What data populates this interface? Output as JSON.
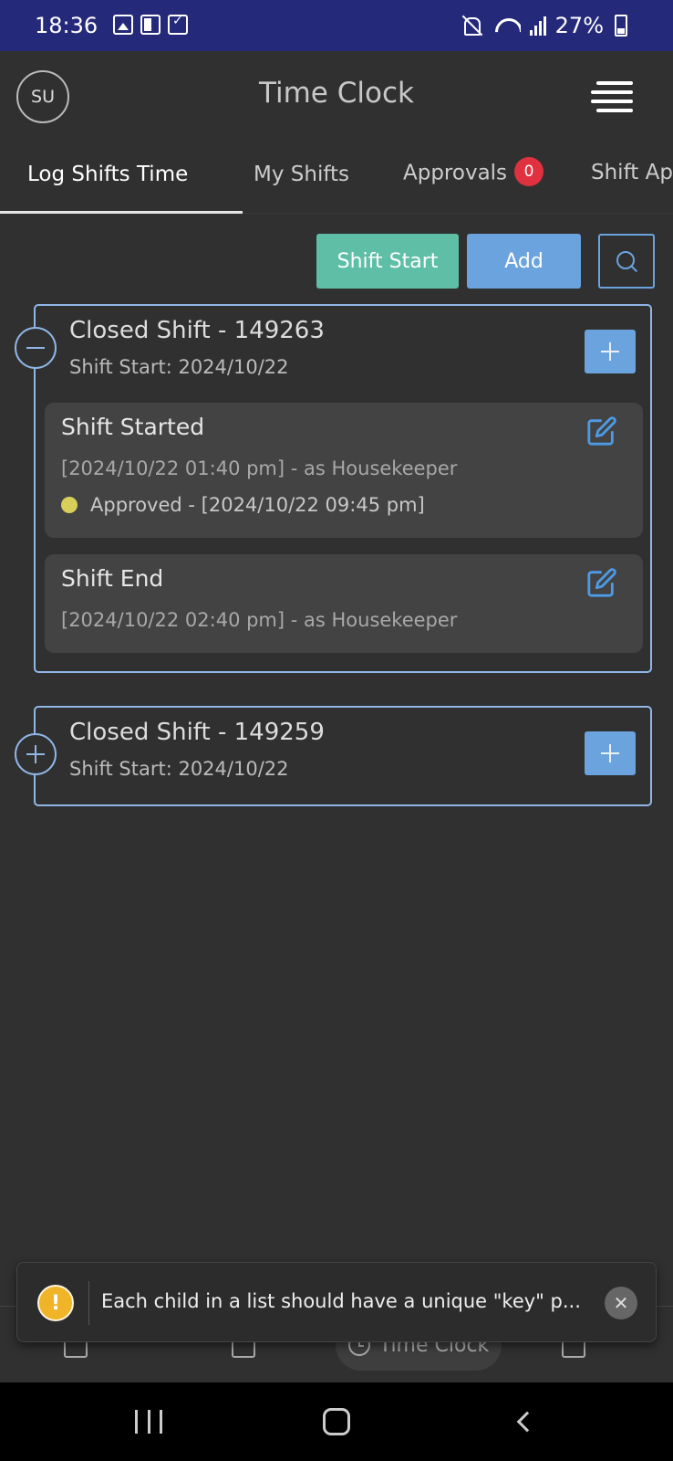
{
  "status_bar": {
    "time": "18:36",
    "battery": "27%",
    "icons": [
      "image-icon",
      "card-icon",
      "task-check-icon",
      "mute-icon",
      "wifi-icon",
      "signal-icon",
      "battery-charging-icon"
    ]
  },
  "app_bar": {
    "avatar_initials": "SU",
    "title": "Time Clock",
    "menu_icon": "hamburger-menu-icon"
  },
  "tabs": [
    {
      "label": "Log Shifts Time",
      "active": true
    },
    {
      "label": "My Shifts",
      "active": false
    },
    {
      "label": "Approvals",
      "badge": "0",
      "active": false
    },
    {
      "label": "Shift Ap",
      "active": false
    }
  ],
  "toolbar": {
    "shift_start_label": "Shift Start",
    "add_label": "Add",
    "search_icon": "search-icon"
  },
  "shifts": [
    {
      "title": "Closed Shift - 149263",
      "subtitle": "Shift Start: 2024/10/22",
      "expanded": true,
      "events": [
        {
          "title": "Shift Started",
          "detail": "[2024/10/22 01:40 pm] - as Housekeeper",
          "status": "Approved - [2024/10/22 09:45 pm]"
        },
        {
          "title": "Shift End",
          "detail": "[2024/10/22 02:40 pm] - as Housekeeper"
        }
      ]
    },
    {
      "title": "Closed Shift - 149259",
      "subtitle": "Shift Start: 2024/10/22",
      "expanded": false,
      "events": []
    }
  ],
  "bottom_nav": {
    "active_label": "Time Clock"
  },
  "toast": {
    "message": "Each child in a list should have a unique \"key\" p..."
  },
  "colors": {
    "status_bar": "#25297a",
    "background": "#303030",
    "shift_start_button": "#5fbfa6",
    "accent_blue": "#6aa3dd",
    "badge_red": "#e03141",
    "status_dot": "#d8cf5a",
    "warning": "#f0b429"
  }
}
